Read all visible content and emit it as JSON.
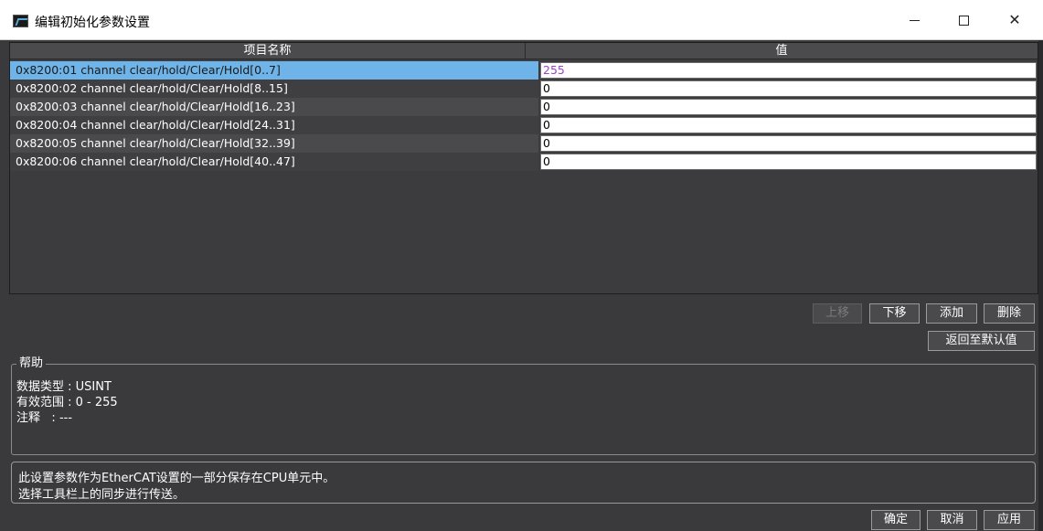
{
  "window": {
    "title": "编辑初始化参数设置",
    "minimize_glyph": "",
    "close_glyph": "✕"
  },
  "table": {
    "columns": [
      "项目名称",
      "值"
    ],
    "rows": [
      {
        "name": "0x8200:01 channel clear/hold/Clear/Hold[0..7]",
        "value": "255",
        "selected": true
      },
      {
        "name": "0x8200:02 channel clear/hold/Clear/Hold[8..15]",
        "value": "0",
        "selected": false
      },
      {
        "name": "0x8200:03 channel clear/hold/Clear/Hold[16..23]",
        "value": "0",
        "selected": false
      },
      {
        "name": "0x8200:04 channel clear/hold/Clear/Hold[24..31]",
        "value": "0",
        "selected": false
      },
      {
        "name": "0x8200:05 channel clear/hold/Clear/Hold[32..39]",
        "value": "0",
        "selected": false
      },
      {
        "name": "0x8200:06 channel clear/hold/Clear/Hold[40..47]",
        "value": "0",
        "selected": false
      }
    ]
  },
  "actions": {
    "move_up": "上移",
    "move_down": "下移",
    "add": "添加",
    "delete": "删除",
    "reset_default": "返回至默认值"
  },
  "help": {
    "legend": "帮助",
    "data_type_label": "数据类型 : ",
    "data_type_value": "USINT",
    "range_label": "有效范围 : ",
    "range_value": "0 - 255",
    "comment_label": "注释",
    "comment_sep": "   : ",
    "comment_value": "---"
  },
  "info": {
    "line1": "此设置参数作为EtherCAT设置的一部分保存在CPU单元中。",
    "line2": "选择工具栏上的同步进行传送。"
  },
  "footer": {
    "ok": "确定",
    "cancel": "取消",
    "apply": "应用"
  },
  "colors": {
    "selected_row": "#6fb4e8",
    "selected_value_text": "#a040c8",
    "background": "#3a3a3c"
  }
}
